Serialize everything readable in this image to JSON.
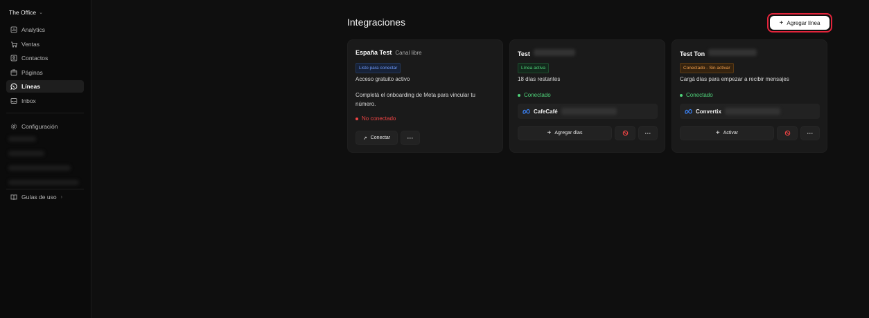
{
  "sidebar": {
    "workspace": "The Office",
    "items": [
      {
        "label": "Analytics",
        "icon": "chart-icon"
      },
      {
        "label": "Ventas",
        "icon": "cart-icon"
      },
      {
        "label": "Contactos",
        "icon": "contacts-icon"
      },
      {
        "label": "Páginas",
        "icon": "pages-icon"
      },
      {
        "label": "Líneas",
        "icon": "whatsapp-icon",
        "active": true
      },
      {
        "label": "Inbox",
        "icon": "inbox-icon"
      }
    ],
    "settings": "Configuración",
    "guides": "Guías de uso"
  },
  "header": {
    "title": "Integraciones",
    "add_button": "Agregar línea"
  },
  "cards": [
    {
      "title": "España Test",
      "subtitle": "Canal libre",
      "badge": "Listo para conectar",
      "line1": "Acceso gratuito activo",
      "line2": "Completá el onboarding de Meta para vincular tu número.",
      "status": "No conectado",
      "primary_button": "Conectar",
      "more": "···"
    },
    {
      "title": "Test",
      "badge": "Línea activa",
      "line1": "18 días restantes",
      "status": "Conectado",
      "phone": "CafeCafé",
      "primary_button": "Agregar días",
      "more": "···"
    },
    {
      "title": "Test Ton",
      "badge": "Conectado - Sin activar",
      "line1": "Cargá días para empezar a recibir mensajes",
      "status": "Conectado",
      "phone": "Convertix",
      "primary_button": "Activar",
      "more": "···"
    }
  ],
  "colors": {
    "accent_red": "#e3243b",
    "connected_green": "#4fd37a",
    "error_red": "#ef4444"
  }
}
